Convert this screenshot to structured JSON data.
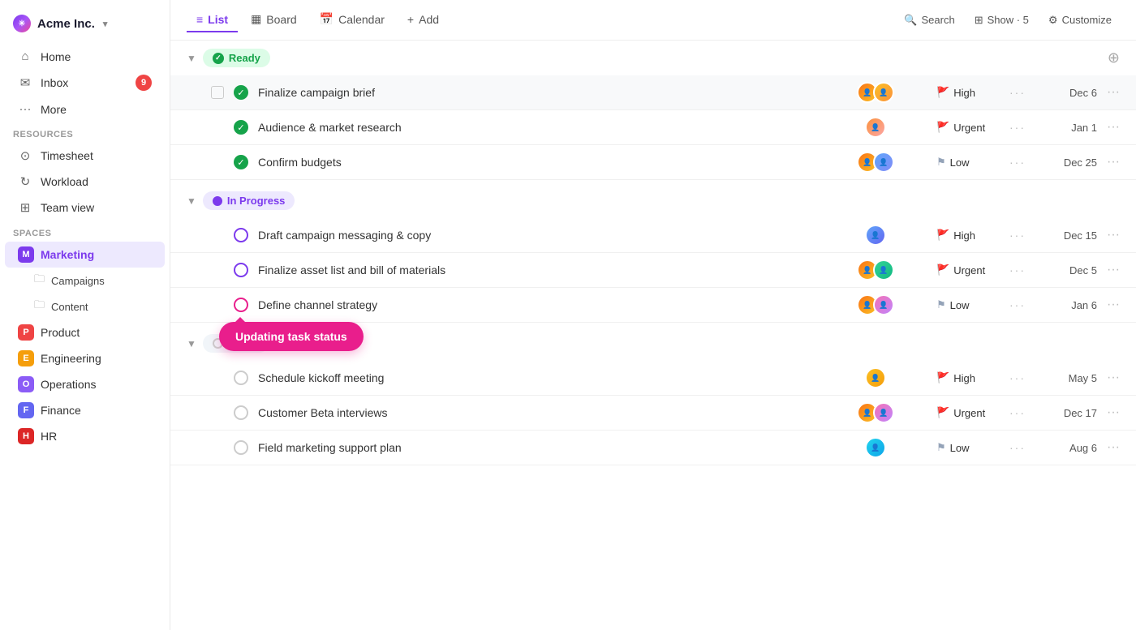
{
  "app": {
    "logo": "✳",
    "company": "Acme Inc.",
    "caret": "▾"
  },
  "sidebar": {
    "nav": [
      {
        "id": "home",
        "icon": "⌂",
        "label": "Home",
        "badge": null
      },
      {
        "id": "inbox",
        "icon": "✉",
        "label": "Inbox",
        "badge": "9"
      },
      {
        "id": "more",
        "icon": "•••",
        "label": "More",
        "badge": null
      }
    ],
    "resources_label": "Resources",
    "resources": [
      {
        "id": "timesheet",
        "icon": "⊙",
        "label": "Timesheet"
      },
      {
        "id": "workload",
        "icon": "↻",
        "label": "Workload"
      },
      {
        "id": "teamview",
        "icon": "⊞",
        "label": "Team view"
      }
    ],
    "spaces_label": "Spaces",
    "spaces": [
      {
        "id": "marketing",
        "label": "Marketing",
        "letter": "M",
        "color": "marketing",
        "active": true
      },
      {
        "id": "product",
        "label": "Product",
        "letter": "P",
        "color": "product",
        "active": false
      },
      {
        "id": "engineering",
        "label": "Engineering",
        "letter": "E",
        "color": "engineering",
        "active": false
      },
      {
        "id": "operations",
        "label": "Operations",
        "letter": "O",
        "color": "operations",
        "active": false
      },
      {
        "id": "finance",
        "label": "Finance",
        "letter": "F",
        "color": "finance",
        "active": false
      },
      {
        "id": "hr",
        "label": "HR",
        "letter": "H",
        "color": "hr",
        "active": false
      }
    ],
    "sub_items": [
      {
        "id": "campaigns",
        "label": "Campaigns"
      },
      {
        "id": "content",
        "label": "Content"
      }
    ]
  },
  "topbar": {
    "tabs": [
      {
        "id": "list",
        "icon": "≡",
        "label": "List",
        "active": true
      },
      {
        "id": "board",
        "icon": "▦",
        "label": "Board",
        "active": false
      },
      {
        "id": "calendar",
        "icon": "📅",
        "label": "Calendar",
        "active": false
      },
      {
        "id": "add",
        "icon": "+",
        "label": "Add",
        "active": false
      }
    ],
    "actions": [
      {
        "id": "search",
        "icon": "🔍",
        "label": "Search"
      },
      {
        "id": "show",
        "icon": "⊞",
        "label": "Show · 5"
      },
      {
        "id": "customize",
        "icon": "⚙",
        "label": "Customize"
      }
    ]
  },
  "groups": [
    {
      "id": "ready",
      "status": "Ready",
      "status_type": "ready",
      "tasks": [
        {
          "id": "t1",
          "name": "Finalize campaign brief",
          "avatars": [
            "a1",
            "a2"
          ],
          "priority": "High",
          "priority_type": "high",
          "date": "Dec 6",
          "status_icon": "done",
          "highlighted": true
        },
        {
          "id": "t2",
          "name": "Audience & market research",
          "avatars": [
            "a3"
          ],
          "priority": "Urgent",
          "priority_type": "urgent",
          "date": "Jan 1",
          "status_icon": "done"
        },
        {
          "id": "t3",
          "name": "Confirm budgets",
          "avatars": [
            "a1",
            "a4"
          ],
          "priority": "Low",
          "priority_type": "low",
          "date": "Dec 25",
          "status_icon": "done"
        }
      ]
    },
    {
      "id": "inprogress",
      "status": "In Progress",
      "status_type": "in-progress",
      "tasks": [
        {
          "id": "t4",
          "name": "Draft campaign messaging & copy",
          "avatars": [
            "a4"
          ],
          "priority": "High",
          "priority_type": "high",
          "date": "Dec 15",
          "status_icon": "inprog"
        },
        {
          "id": "t5",
          "name": "Finalize asset list and bill of materials",
          "avatars": [
            "a1",
            "a5"
          ],
          "priority": "Urgent",
          "priority_type": "urgent",
          "date": "Dec 5",
          "status_icon": "inprog"
        },
        {
          "id": "t6",
          "name": "Define channel strategy",
          "avatars": [
            "a1",
            "a6"
          ],
          "priority": "Low",
          "priority_type": "low",
          "date": "Jan 6",
          "status_icon": "inprog",
          "has_tooltip": true,
          "tooltip_text": "Updating task status"
        }
      ]
    },
    {
      "id": "todo",
      "status": "To Do",
      "status_type": "todo",
      "tasks": [
        {
          "id": "t7",
          "name": "Schedule kickoff meeting",
          "avatars": [
            "a7"
          ],
          "priority": "High",
          "priority_type": "high",
          "date": "May 5",
          "status_icon": "circle"
        },
        {
          "id": "t8",
          "name": "Customer Beta interviews",
          "avatars": [
            "a1",
            "a6"
          ],
          "priority": "Urgent",
          "priority_type": "urgent",
          "date": "Dec 17",
          "status_icon": "circle"
        },
        {
          "id": "t9",
          "name": "Field marketing support plan",
          "avatars": [
            "a8"
          ],
          "priority": "Low",
          "priority_type": "low",
          "date": "Aug 6",
          "status_icon": "circle"
        }
      ]
    }
  ],
  "priority_flags": {
    "high": "🚩",
    "urgent": "🚩",
    "low": "⚑"
  },
  "tooltip": "Updating task status"
}
